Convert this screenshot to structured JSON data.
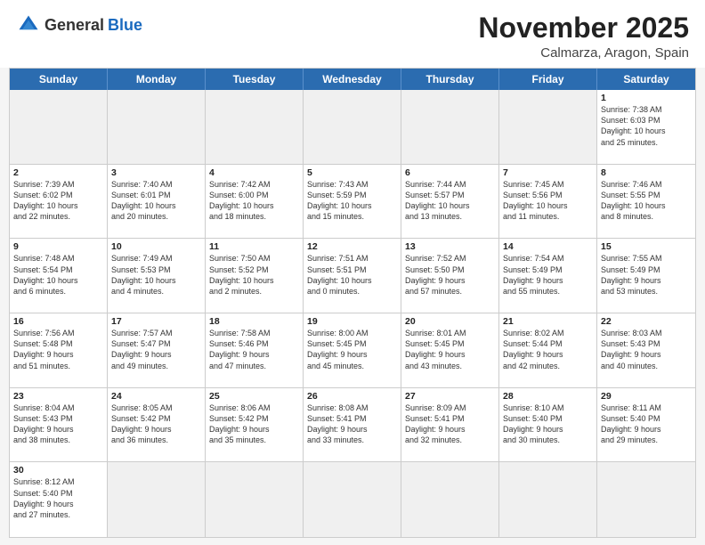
{
  "header": {
    "logo_general": "General",
    "logo_blue": "Blue",
    "month_title": "November 2025",
    "location": "Calmarza, Aragon, Spain"
  },
  "day_headers": [
    "Sunday",
    "Monday",
    "Tuesday",
    "Wednesday",
    "Thursday",
    "Friday",
    "Saturday"
  ],
  "days": [
    {
      "num": "",
      "info": "",
      "empty": true
    },
    {
      "num": "",
      "info": "",
      "empty": true
    },
    {
      "num": "",
      "info": "",
      "empty": true
    },
    {
      "num": "",
      "info": "",
      "empty": true
    },
    {
      "num": "",
      "info": "",
      "empty": true
    },
    {
      "num": "",
      "info": "",
      "empty": true
    },
    {
      "num": "1",
      "info": "Sunrise: 7:38 AM\nSunset: 6:03 PM\nDaylight: 10 hours\nand 25 minutes."
    },
    {
      "num": "2",
      "info": "Sunrise: 7:39 AM\nSunset: 6:02 PM\nDaylight: 10 hours\nand 22 minutes."
    },
    {
      "num": "3",
      "info": "Sunrise: 7:40 AM\nSunset: 6:01 PM\nDaylight: 10 hours\nand 20 minutes."
    },
    {
      "num": "4",
      "info": "Sunrise: 7:42 AM\nSunset: 6:00 PM\nDaylight: 10 hours\nand 18 minutes."
    },
    {
      "num": "5",
      "info": "Sunrise: 7:43 AM\nSunset: 5:59 PM\nDaylight: 10 hours\nand 15 minutes."
    },
    {
      "num": "6",
      "info": "Sunrise: 7:44 AM\nSunset: 5:57 PM\nDaylight: 10 hours\nand 13 minutes."
    },
    {
      "num": "7",
      "info": "Sunrise: 7:45 AM\nSunset: 5:56 PM\nDaylight: 10 hours\nand 11 minutes."
    },
    {
      "num": "8",
      "info": "Sunrise: 7:46 AM\nSunset: 5:55 PM\nDaylight: 10 hours\nand 8 minutes."
    },
    {
      "num": "9",
      "info": "Sunrise: 7:48 AM\nSunset: 5:54 PM\nDaylight: 10 hours\nand 6 minutes."
    },
    {
      "num": "10",
      "info": "Sunrise: 7:49 AM\nSunset: 5:53 PM\nDaylight: 10 hours\nand 4 minutes."
    },
    {
      "num": "11",
      "info": "Sunrise: 7:50 AM\nSunset: 5:52 PM\nDaylight: 10 hours\nand 2 minutes."
    },
    {
      "num": "12",
      "info": "Sunrise: 7:51 AM\nSunset: 5:51 PM\nDaylight: 10 hours\nand 0 minutes."
    },
    {
      "num": "13",
      "info": "Sunrise: 7:52 AM\nSunset: 5:50 PM\nDaylight: 9 hours\nand 57 minutes."
    },
    {
      "num": "14",
      "info": "Sunrise: 7:54 AM\nSunset: 5:49 PM\nDaylight: 9 hours\nand 55 minutes."
    },
    {
      "num": "15",
      "info": "Sunrise: 7:55 AM\nSunset: 5:49 PM\nDaylight: 9 hours\nand 53 minutes."
    },
    {
      "num": "16",
      "info": "Sunrise: 7:56 AM\nSunset: 5:48 PM\nDaylight: 9 hours\nand 51 minutes."
    },
    {
      "num": "17",
      "info": "Sunrise: 7:57 AM\nSunset: 5:47 PM\nDaylight: 9 hours\nand 49 minutes."
    },
    {
      "num": "18",
      "info": "Sunrise: 7:58 AM\nSunset: 5:46 PM\nDaylight: 9 hours\nand 47 minutes."
    },
    {
      "num": "19",
      "info": "Sunrise: 8:00 AM\nSunset: 5:45 PM\nDaylight: 9 hours\nand 45 minutes."
    },
    {
      "num": "20",
      "info": "Sunrise: 8:01 AM\nSunset: 5:45 PM\nDaylight: 9 hours\nand 43 minutes."
    },
    {
      "num": "21",
      "info": "Sunrise: 8:02 AM\nSunset: 5:44 PM\nDaylight: 9 hours\nand 42 minutes."
    },
    {
      "num": "22",
      "info": "Sunrise: 8:03 AM\nSunset: 5:43 PM\nDaylight: 9 hours\nand 40 minutes."
    },
    {
      "num": "23",
      "info": "Sunrise: 8:04 AM\nSunset: 5:43 PM\nDaylight: 9 hours\nand 38 minutes."
    },
    {
      "num": "24",
      "info": "Sunrise: 8:05 AM\nSunset: 5:42 PM\nDaylight: 9 hours\nand 36 minutes."
    },
    {
      "num": "25",
      "info": "Sunrise: 8:06 AM\nSunset: 5:42 PM\nDaylight: 9 hours\nand 35 minutes."
    },
    {
      "num": "26",
      "info": "Sunrise: 8:08 AM\nSunset: 5:41 PM\nDaylight: 9 hours\nand 33 minutes."
    },
    {
      "num": "27",
      "info": "Sunrise: 8:09 AM\nSunset: 5:41 PM\nDaylight: 9 hours\nand 32 minutes."
    },
    {
      "num": "28",
      "info": "Sunrise: 8:10 AM\nSunset: 5:40 PM\nDaylight: 9 hours\nand 30 minutes."
    },
    {
      "num": "29",
      "info": "Sunrise: 8:11 AM\nSunset: 5:40 PM\nDaylight: 9 hours\nand 29 minutes."
    },
    {
      "num": "30",
      "info": "Sunrise: 8:12 AM\nSunset: 5:40 PM\nDaylight: 9 hours\nand 27 minutes."
    },
    {
      "num": "",
      "info": "",
      "empty": true
    },
    {
      "num": "",
      "info": "",
      "empty": true
    },
    {
      "num": "",
      "info": "",
      "empty": true
    },
    {
      "num": "",
      "info": "",
      "empty": true
    },
    {
      "num": "",
      "info": "",
      "empty": true
    },
    {
      "num": "",
      "info": "",
      "empty": true
    }
  ]
}
